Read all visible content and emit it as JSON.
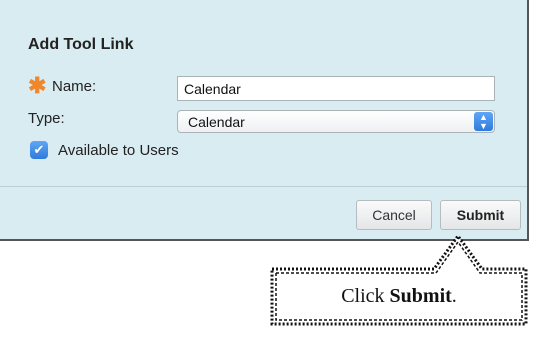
{
  "dialog": {
    "title": "Add Tool Link",
    "name_label": "Name:",
    "name_value": "Calendar",
    "type_label": "Type:",
    "type_selected": "Calendar",
    "available_label": "Available to Users",
    "available_checked": true,
    "cancel_label": "Cancel",
    "submit_label": "Submit"
  },
  "callout": {
    "prefix": "Click ",
    "emphasis": "Submit",
    "suffix": "."
  },
  "colors": {
    "panel_bg": "#d9ecf1",
    "required_accent": "#f0872a",
    "control_blue": "#3b86e8"
  }
}
